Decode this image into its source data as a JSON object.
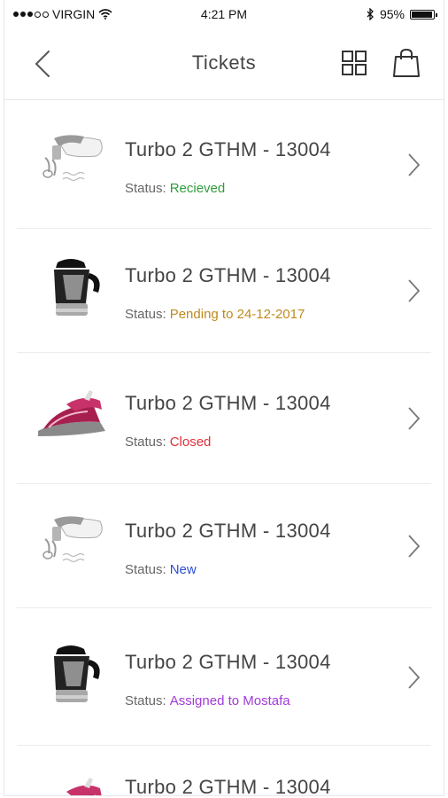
{
  "status_bar": {
    "carrier": "VIRGIN",
    "time": "4:21 PM",
    "battery": "95%",
    "battery_level": 0.95
  },
  "nav": {
    "title": "Tickets"
  },
  "tickets": [
    {
      "title": "Turbo 2 GTHM - 13004",
      "status_label": "Status:",
      "status": "Recieved",
      "status_color": "#2e9e3a",
      "product_icon": "hand-mixer-icon"
    },
    {
      "title": "Turbo 2 GTHM - 13004",
      "status_label": "Status:",
      "status": "Pending to  24-12-2017",
      "status_color": "#c08a1e",
      "product_icon": "citrus-juicer-icon"
    },
    {
      "title": "Turbo 2 GTHM - 13004",
      "status_label": "Status:",
      "status": "Closed",
      "status_color": "#e0303a",
      "product_icon": "steam-iron-icon"
    },
    {
      "title": "Turbo 2 GTHM - 13004",
      "status_label": "Status:",
      "status": "New",
      "status_color": "#2f4fd6",
      "product_icon": "hand-mixer-icon"
    },
    {
      "title": "Turbo 2 GTHM - 13004",
      "status_label": "Status:",
      "status": "Assigned to Mostafa",
      "status_color": "#a23ad8",
      "product_icon": "citrus-juicer-icon"
    },
    {
      "title": "Turbo 2 GTHM - 13004",
      "status_label": "",
      "status": "",
      "status_color": "#333333",
      "product_icon": "steam-iron-icon"
    }
  ]
}
